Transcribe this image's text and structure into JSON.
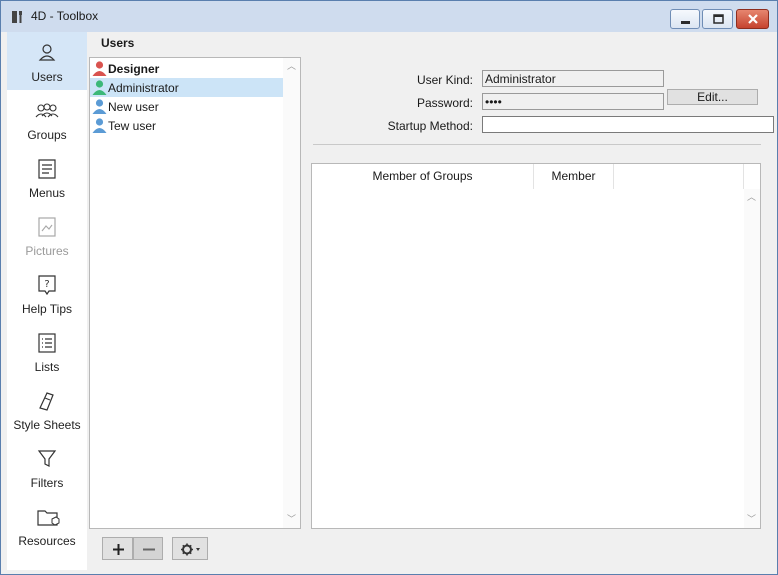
{
  "window": {
    "title": "4D - Toolbox"
  },
  "sidebar": {
    "items": [
      {
        "label": "Users",
        "icon": "user-icon"
      },
      {
        "label": "Groups",
        "icon": "groups-icon"
      },
      {
        "label": "Menus",
        "icon": "menu-icon"
      },
      {
        "label": "Pictures",
        "icon": "picture-icon"
      },
      {
        "label": "Help Tips",
        "icon": "help-tip-icon"
      },
      {
        "label": "Lists",
        "icon": "list-icon"
      },
      {
        "label": "Style Sheets",
        "icon": "style-sheet-icon"
      },
      {
        "label": "Filters",
        "icon": "filter-icon"
      },
      {
        "label": "Resources",
        "icon": "folder-icon"
      }
    ]
  },
  "main": {
    "section_title": "Users",
    "users": [
      {
        "name": "Designer",
        "color": "#d9534f"
      },
      {
        "name": "Administrator",
        "color": "#3cb878"
      },
      {
        "name": "New user",
        "color": "#5b9bd5"
      },
      {
        "name": "Tew user",
        "color": "#5b9bd5"
      }
    ],
    "form": {
      "user_kind_label": "User Kind:",
      "user_kind_value": "Administrator",
      "password_label": "Password:",
      "password_value": "••••",
      "edit_label": "Edit...",
      "startup_label": "Startup Method:",
      "startup_value": ""
    },
    "groups_table": {
      "columns": [
        "Member of Groups",
        "Member"
      ]
    },
    "buttons": {
      "add": "+",
      "remove": "−"
    }
  },
  "colors": {
    "accent": "#d5e6f7",
    "selection": "#cce4f7"
  }
}
